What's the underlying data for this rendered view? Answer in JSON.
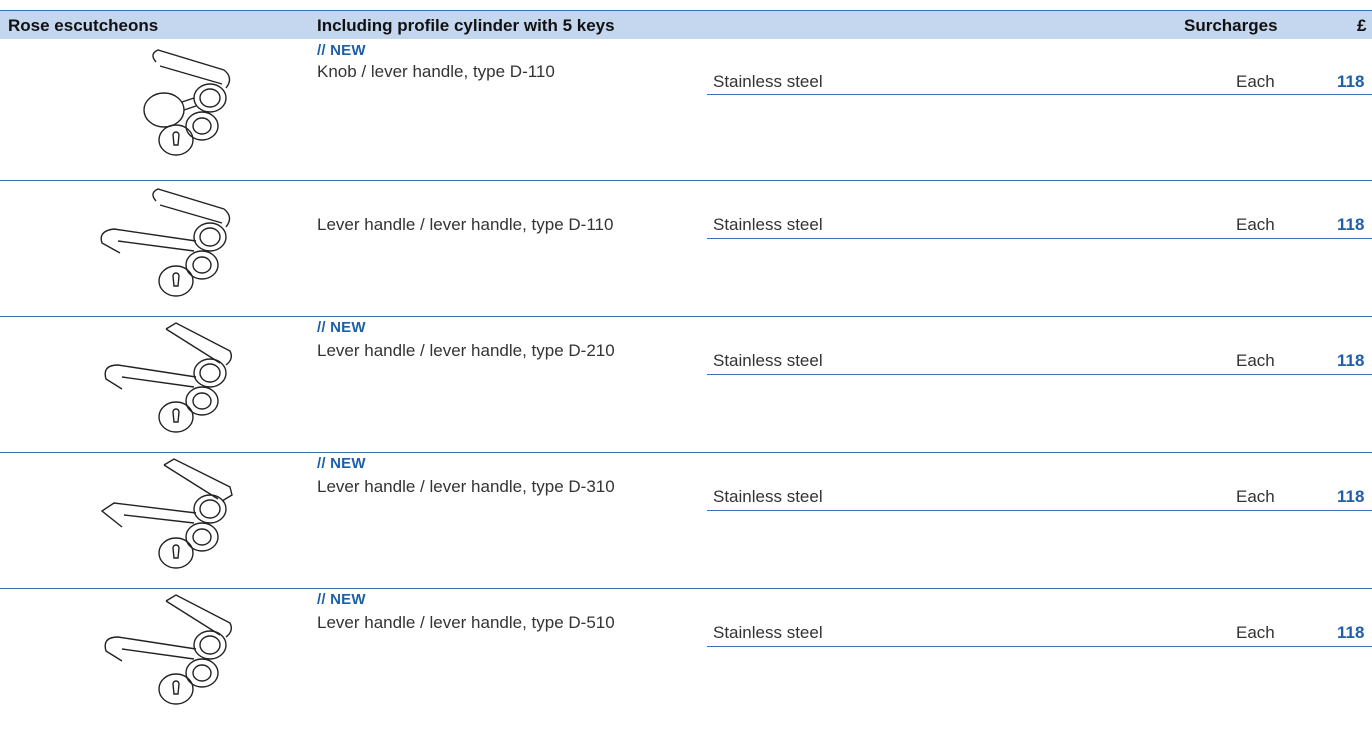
{
  "header": {
    "col1": "Rose escutcheons",
    "col2": "Including profile cylinder with 5 keys",
    "col3": "Surcharges",
    "col4": "£"
  },
  "colors": {
    "accent": "#1f5fa8",
    "header_bg": "#c4d7ef",
    "rule": "#3f6fb3"
  },
  "rows": [
    {
      "badge": "// NEW",
      "description": "Knob / lever handle, type D-110",
      "material": "Stainless steel",
      "unit": "Each",
      "price": "118",
      "icon": "knob-lever-handle-illustration"
    },
    {
      "badge": "",
      "description": "Lever handle / lever handle, type D-110",
      "material": "Stainless steel",
      "unit": "Each",
      "price": "118",
      "icon": "lever-handle-illustration"
    },
    {
      "badge": "// NEW",
      "description": "Lever handle / lever handle, type D-210",
      "material": "Stainless steel",
      "unit": "Each",
      "price": "118",
      "icon": "lever-handle-illustration"
    },
    {
      "badge": "// NEW",
      "description": "Lever handle / lever handle, type D-310",
      "material": "Stainless steel",
      "unit": "Each",
      "price": "118",
      "icon": "lever-handle-illustration"
    },
    {
      "badge": "// NEW",
      "description": "Lever handle / lever handle, type D-510",
      "material": "Stainless steel",
      "unit": "Each",
      "price": "118",
      "icon": "lever-handle-illustration"
    }
  ]
}
